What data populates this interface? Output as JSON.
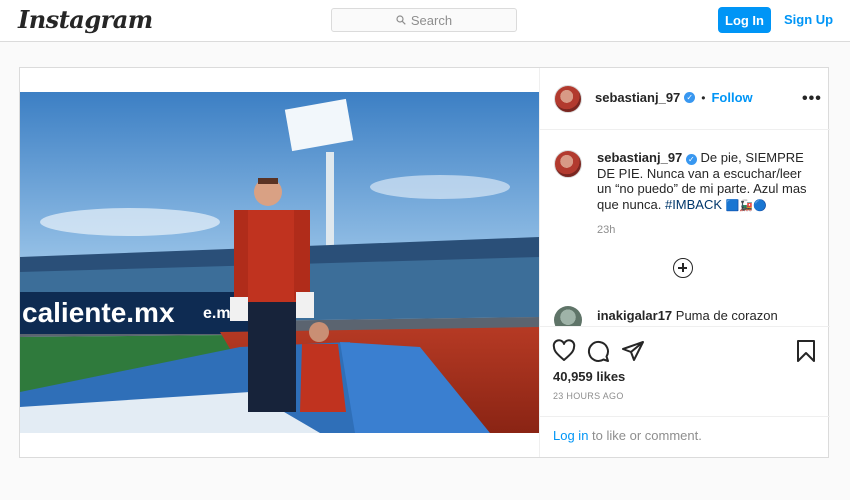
{
  "header": {
    "logo": "Instagram",
    "search_placeholder": "Search",
    "login_label": "Log In",
    "signup_label": "Sign Up"
  },
  "post": {
    "author": "sebastianj_97",
    "follow_label": "Follow",
    "more_label": "•••",
    "caption_text": "De pie, SIEMPRE DE PIE. Nunca van a escuchar/leer un “no puedo” de mi parte. Azul mas que nunca.",
    "hashtag": "#IMBACK",
    "caption_emoji": "🟦🚂🔵",
    "time_ago": "23h",
    "comment": {
      "user": "inakigalar17",
      "text": "Puma de corazon"
    },
    "likes": "40,959 likes",
    "date": "23 HOURS AGO",
    "login_link": "Log in",
    "login_suffix": "to like or comment.",
    "image_text": {
      "sponsor": "caliente.mx",
      "sponsor_suffix": "e.mx"
    }
  },
  "colors": {
    "accent": "#0095f6",
    "verified": "#3897f0"
  },
  "icons": [
    "search-icon",
    "verified-icon",
    "more-icon",
    "plus-circle-icon",
    "heart-icon",
    "comment-icon",
    "share-icon",
    "bookmark-icon"
  ]
}
